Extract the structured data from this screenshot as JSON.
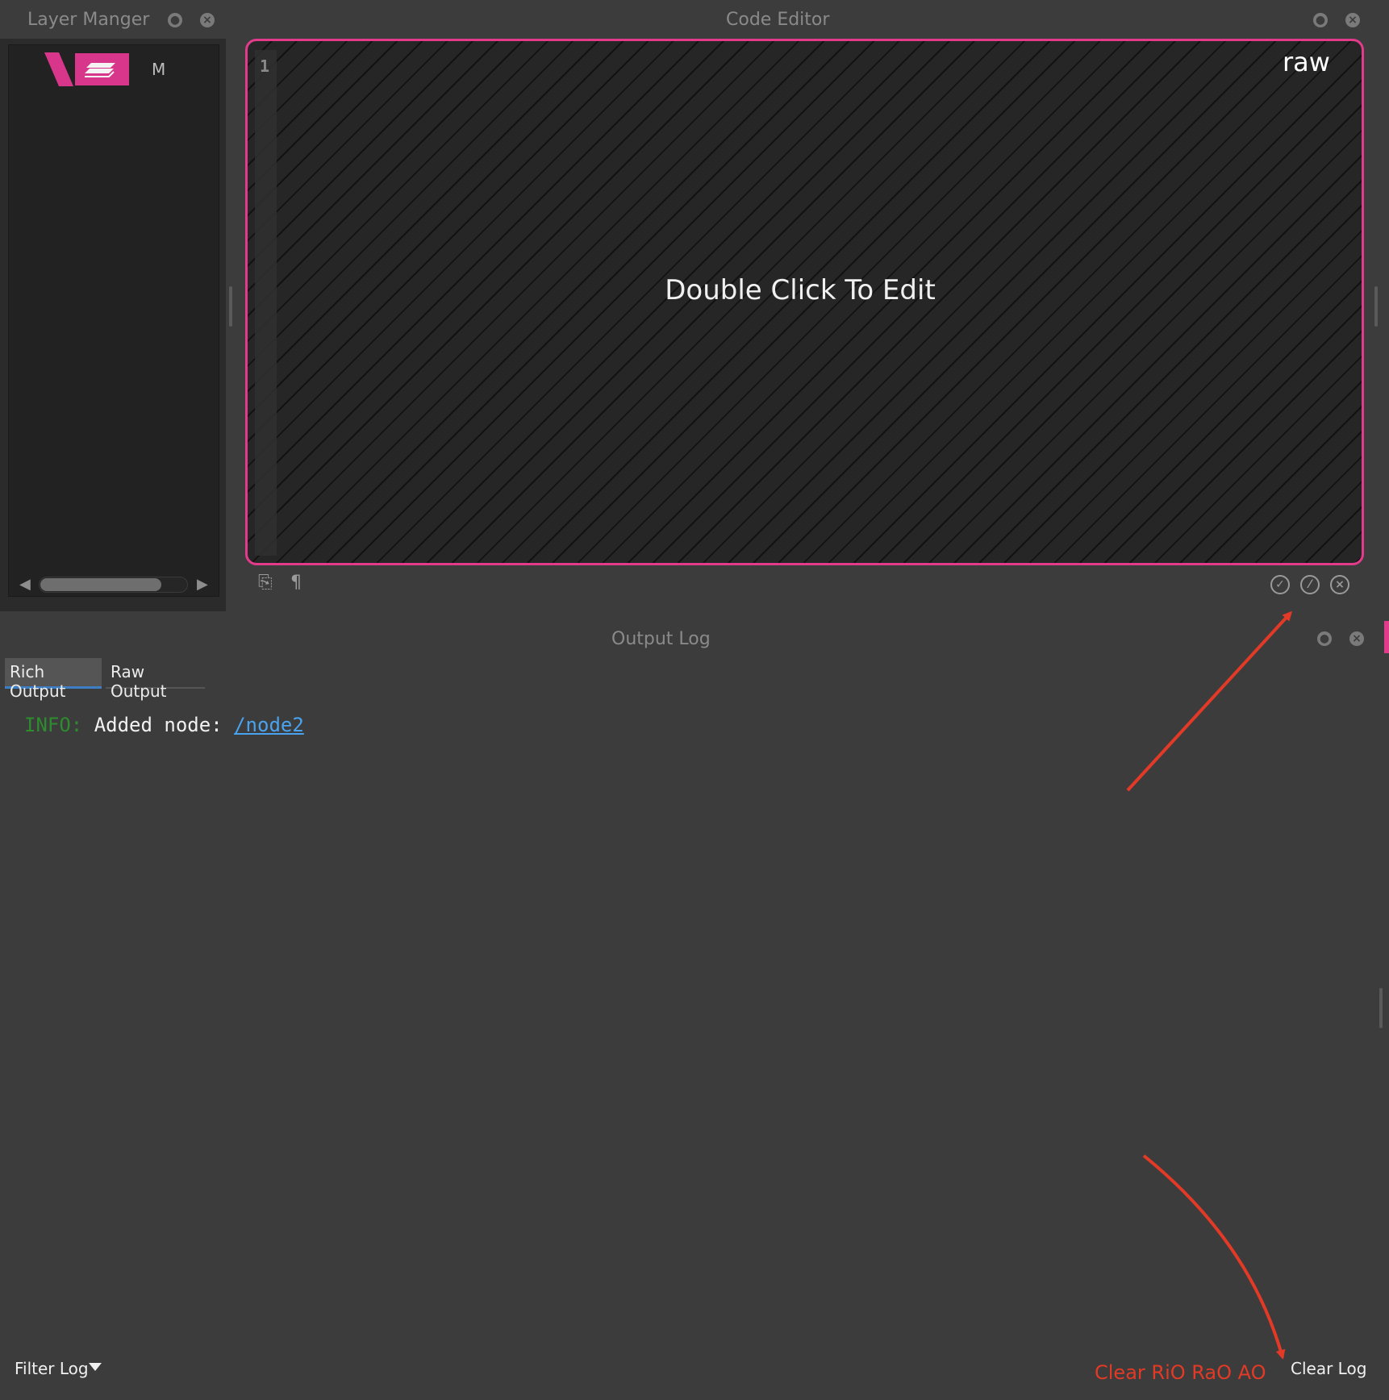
{
  "layer_manager": {
    "title": "Layer Manger",
    "layer_item_label": "M"
  },
  "code_editor": {
    "title": "Code Editor",
    "line_number": "1",
    "mode_label": "raw",
    "hint": "Double Click To Edit"
  },
  "output_log": {
    "title": "Output Log",
    "tabs": [
      {
        "label": "Rich Output",
        "active": true
      },
      {
        "label": "Raw Output",
        "active": false
      }
    ],
    "entries": [
      {
        "level": "INFO:",
        "message": "Added node: ",
        "link": "/node2"
      }
    ],
    "filter_label": "Filter Log",
    "clear_label": "Clear Log"
  },
  "annotation": {
    "text": "Clear RiO RaO AO",
    "color": "#e23a26"
  },
  "colors": {
    "accent": "#e23b8c",
    "tab_underline": "#3d7ec5",
    "info": "#2e8b2e",
    "link": "#4aa3f0"
  }
}
